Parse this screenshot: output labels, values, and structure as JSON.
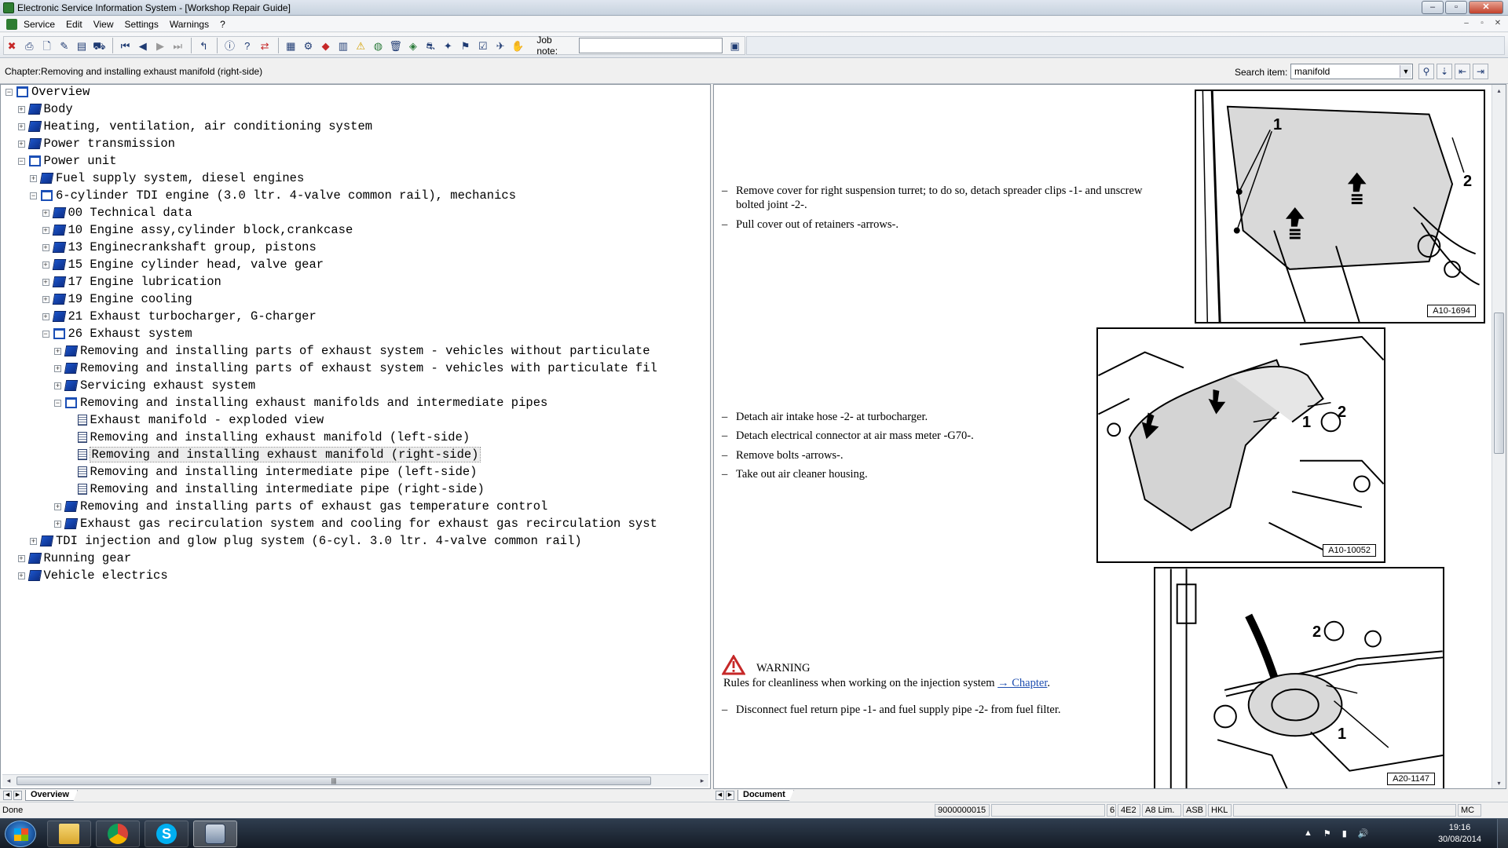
{
  "window": {
    "title": "Electronic Service Information System - [Workshop Repair Guide]",
    "controls": {
      "minimize": "–",
      "restore": "▫",
      "close": "✕"
    }
  },
  "menu": {
    "items": [
      "Service",
      "Edit",
      "View",
      "Settings",
      "Warnings",
      "?"
    ],
    "mdi_controls": [
      "–",
      "▫",
      "✕"
    ]
  },
  "toolbar": {
    "job_note_label": "Job note:",
    "job_note_value": ""
  },
  "chapter": {
    "label": "Chapter:Removing and installing exhaust manifold (right-side)"
  },
  "search": {
    "label": "Search item:",
    "value": "manifold"
  },
  "tree": {
    "items": [
      {
        "level": 0,
        "expander": "−",
        "icon": "open",
        "label": "Overview"
      },
      {
        "level": 1,
        "expander": "+",
        "icon": "book",
        "label": "Body"
      },
      {
        "level": 1,
        "expander": "+",
        "icon": "book",
        "label": "Heating, ventilation, air conditioning system"
      },
      {
        "level": 1,
        "expander": "+",
        "icon": "book",
        "label": "Power transmission"
      },
      {
        "level": 1,
        "expander": "−",
        "icon": "open",
        "label": "Power unit"
      },
      {
        "level": 2,
        "expander": "+",
        "icon": "book",
        "label": "Fuel supply system, diesel engines"
      },
      {
        "level": 2,
        "expander": "−",
        "icon": "open",
        "label": "6-cylinder TDI engine (3.0 ltr. 4-valve common rail), mechanics"
      },
      {
        "level": 3,
        "expander": "+",
        "icon": "book",
        "label": "00 Technical data"
      },
      {
        "level": 3,
        "expander": "+",
        "icon": "book",
        "label": "10 Engine assy,cylinder block,crankcase"
      },
      {
        "level": 3,
        "expander": "+",
        "icon": "book",
        "label": "13 Enginecrankshaft group, pistons"
      },
      {
        "level": 3,
        "expander": "+",
        "icon": "book",
        "label": "15 Engine cylinder head, valve gear"
      },
      {
        "level": 3,
        "expander": "+",
        "icon": "book",
        "label": "17 Engine lubrication"
      },
      {
        "level": 3,
        "expander": "+",
        "icon": "book",
        "label": "19 Engine cooling"
      },
      {
        "level": 3,
        "expander": "+",
        "icon": "book",
        "label": "21 Exhaust turbocharger, G-charger"
      },
      {
        "level": 3,
        "expander": "−",
        "icon": "open",
        "label": "26 Exhaust system"
      },
      {
        "level": 4,
        "expander": "+",
        "icon": "book",
        "label": "Removing and installing parts of exhaust system - vehicles without particulate"
      },
      {
        "level": 4,
        "expander": "+",
        "icon": "book",
        "label": "Removing and installing parts of exhaust system - vehicles with particulate fil"
      },
      {
        "level": 4,
        "expander": "+",
        "icon": "book",
        "label": "Servicing exhaust system"
      },
      {
        "level": 4,
        "expander": "−",
        "icon": "open",
        "label": "Removing and installing exhaust manifolds and intermediate pipes"
      },
      {
        "level": 5,
        "expander": "",
        "icon": "doc",
        "label": "Exhaust manifold - exploded view"
      },
      {
        "level": 5,
        "expander": "",
        "icon": "doc",
        "label": "Removing and installing exhaust manifold (left-side)"
      },
      {
        "level": 5,
        "expander": "",
        "icon": "doc",
        "label": "Removing and installing exhaust manifold (right-side)",
        "selected": true
      },
      {
        "level": 5,
        "expander": "",
        "icon": "doc",
        "label": "Removing and installing intermediate pipe (left-side)"
      },
      {
        "level": 5,
        "expander": "",
        "icon": "doc",
        "label": "Removing and installing intermediate pipe (right-side)"
      },
      {
        "level": 4,
        "expander": "+",
        "icon": "book",
        "label": "Removing and installing parts of exhaust gas temperature control"
      },
      {
        "level": 4,
        "expander": "+",
        "icon": "book",
        "label": "Exhaust gas recirculation system and cooling for exhaust gas recirculation syst"
      },
      {
        "level": 2,
        "expander": "+",
        "icon": "book",
        "label": "TDI injection and glow plug system (6-cyl. 3.0 ltr. 4-valve common rail)"
      },
      {
        "level": 1,
        "expander": "+",
        "icon": "book",
        "label": "Running gear"
      },
      {
        "level": 1,
        "expander": "+",
        "icon": "book",
        "label": "Vehicle electrics"
      }
    ]
  },
  "tabs": {
    "left": "Overview",
    "right": "Document"
  },
  "document": {
    "step1": "Remove cover for right suspension turret; to do so, detach spreader clips -1- and unscrew",
    "step1b": "bolted joint -2-.",
    "step2": "Pull cover out of retainers -arrows-.",
    "step3": "Detach air intake hose -2- at turbocharger.",
    "step4": "Detach electrical connector at air mass meter -G70-.",
    "step5": "Remove bolts -arrows-.",
    "step6": "Take out air cleaner housing.",
    "warning_title": "WARNING",
    "warning_text": "Rules for cleanliness when working on the injection system",
    "warning_link": "→ Chapter",
    "step7": "Disconnect fuel return pipe -1- and fuel supply pipe -2- from fuel filter.",
    "dash": "–",
    "fig1_label": "A10-1694",
    "fig2_label": "A10-10052",
    "fig3_label": "A20-1147",
    "fig1_num1": "1",
    "fig1_num2": "2",
    "fig2_num1": "1",
    "fig2_num2": "2",
    "fig3_num1": "1",
    "fig3_num2": "2"
  },
  "status": {
    "text": "Done",
    "cells": [
      "9000000015",
      "6",
      "4E2",
      "A8 Lim.",
      "ASB",
      "HKL",
      "MC"
    ]
  },
  "taskbar": {
    "time": "19:16",
    "date": "30/08/2014"
  }
}
